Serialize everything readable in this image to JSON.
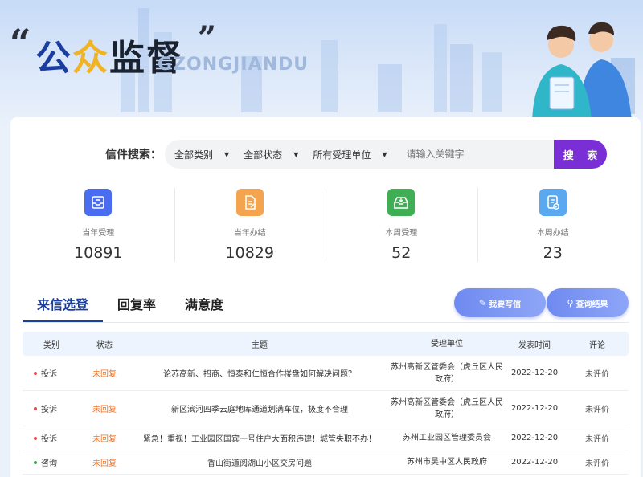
{
  "banner": {
    "quote_open": "“",
    "quote_close": "”",
    "title_a": "公",
    "title_b": "众",
    "title_c": "监督",
    "pinyin": "GZONGJIANDU"
  },
  "search": {
    "label": "信件搜索：",
    "filters": [
      "全部类别",
      "全部状态",
      "所有受理单位"
    ],
    "placeholder": "请输入关键字",
    "button": "搜 索"
  },
  "stats": [
    {
      "label": "当年受理",
      "value": "10891",
      "color": "#4a6cf0",
      "icon": "inbox-icon"
    },
    {
      "label": "当年办结",
      "value": "10829",
      "color": "#f4a44e",
      "icon": "document-edit-icon"
    },
    {
      "label": "本周受理",
      "value": "52",
      "color": "#3fae55",
      "icon": "mail-tray-icon"
    },
    {
      "label": "本周办结",
      "value": "23",
      "color": "#59a8f0",
      "icon": "document-check-icon"
    }
  ],
  "tabs": [
    "来信选登",
    "回复率",
    "满意度"
  ],
  "actions": {
    "write": "我要写信",
    "query": "查询结果"
  },
  "table": {
    "headers": [
      "类别",
      "状态",
      "主题",
      "受理单位",
      "发表时间",
      "评论"
    ],
    "rows": [
      {
        "type": "投诉",
        "dot": "#e9474a",
        "status": "未回复",
        "topic": "论苏高新、招商、恒泰和仁恒合作楼盘如何解决问题？",
        "unit": "苏州高新区管委会（虎丘区人民政府）",
        "time": "2022-12-20",
        "comment": "未评价",
        "h": 44
      },
      {
        "type": "投诉",
        "dot": "#e9474a",
        "status": "未回复",
        "topic": "新区滨河四季云庭地库通道划满车位，极度不合理",
        "unit": "苏州高新区管委会（虎丘区人民政府）",
        "time": "2022-12-20",
        "comment": "未评价",
        "h": 44
      },
      {
        "type": "投诉",
        "dot": "#e9474a",
        "status": "未回复",
        "topic": "紧急！重视！工业园区国宾一号住户大面积违建！城管失职不办！",
        "unit": "苏州工业园区管理委员会",
        "time": "2022-12-20",
        "comment": "未评价",
        "h": 30
      },
      {
        "type": "咨询",
        "dot": "#3aa64c",
        "status": "未回复",
        "topic": "香山街道阅湖山小区交房问题",
        "unit": "苏州市吴中区人民政府",
        "time": "2022-12-20",
        "comment": "未评价",
        "h": 30
      }
    ]
  }
}
